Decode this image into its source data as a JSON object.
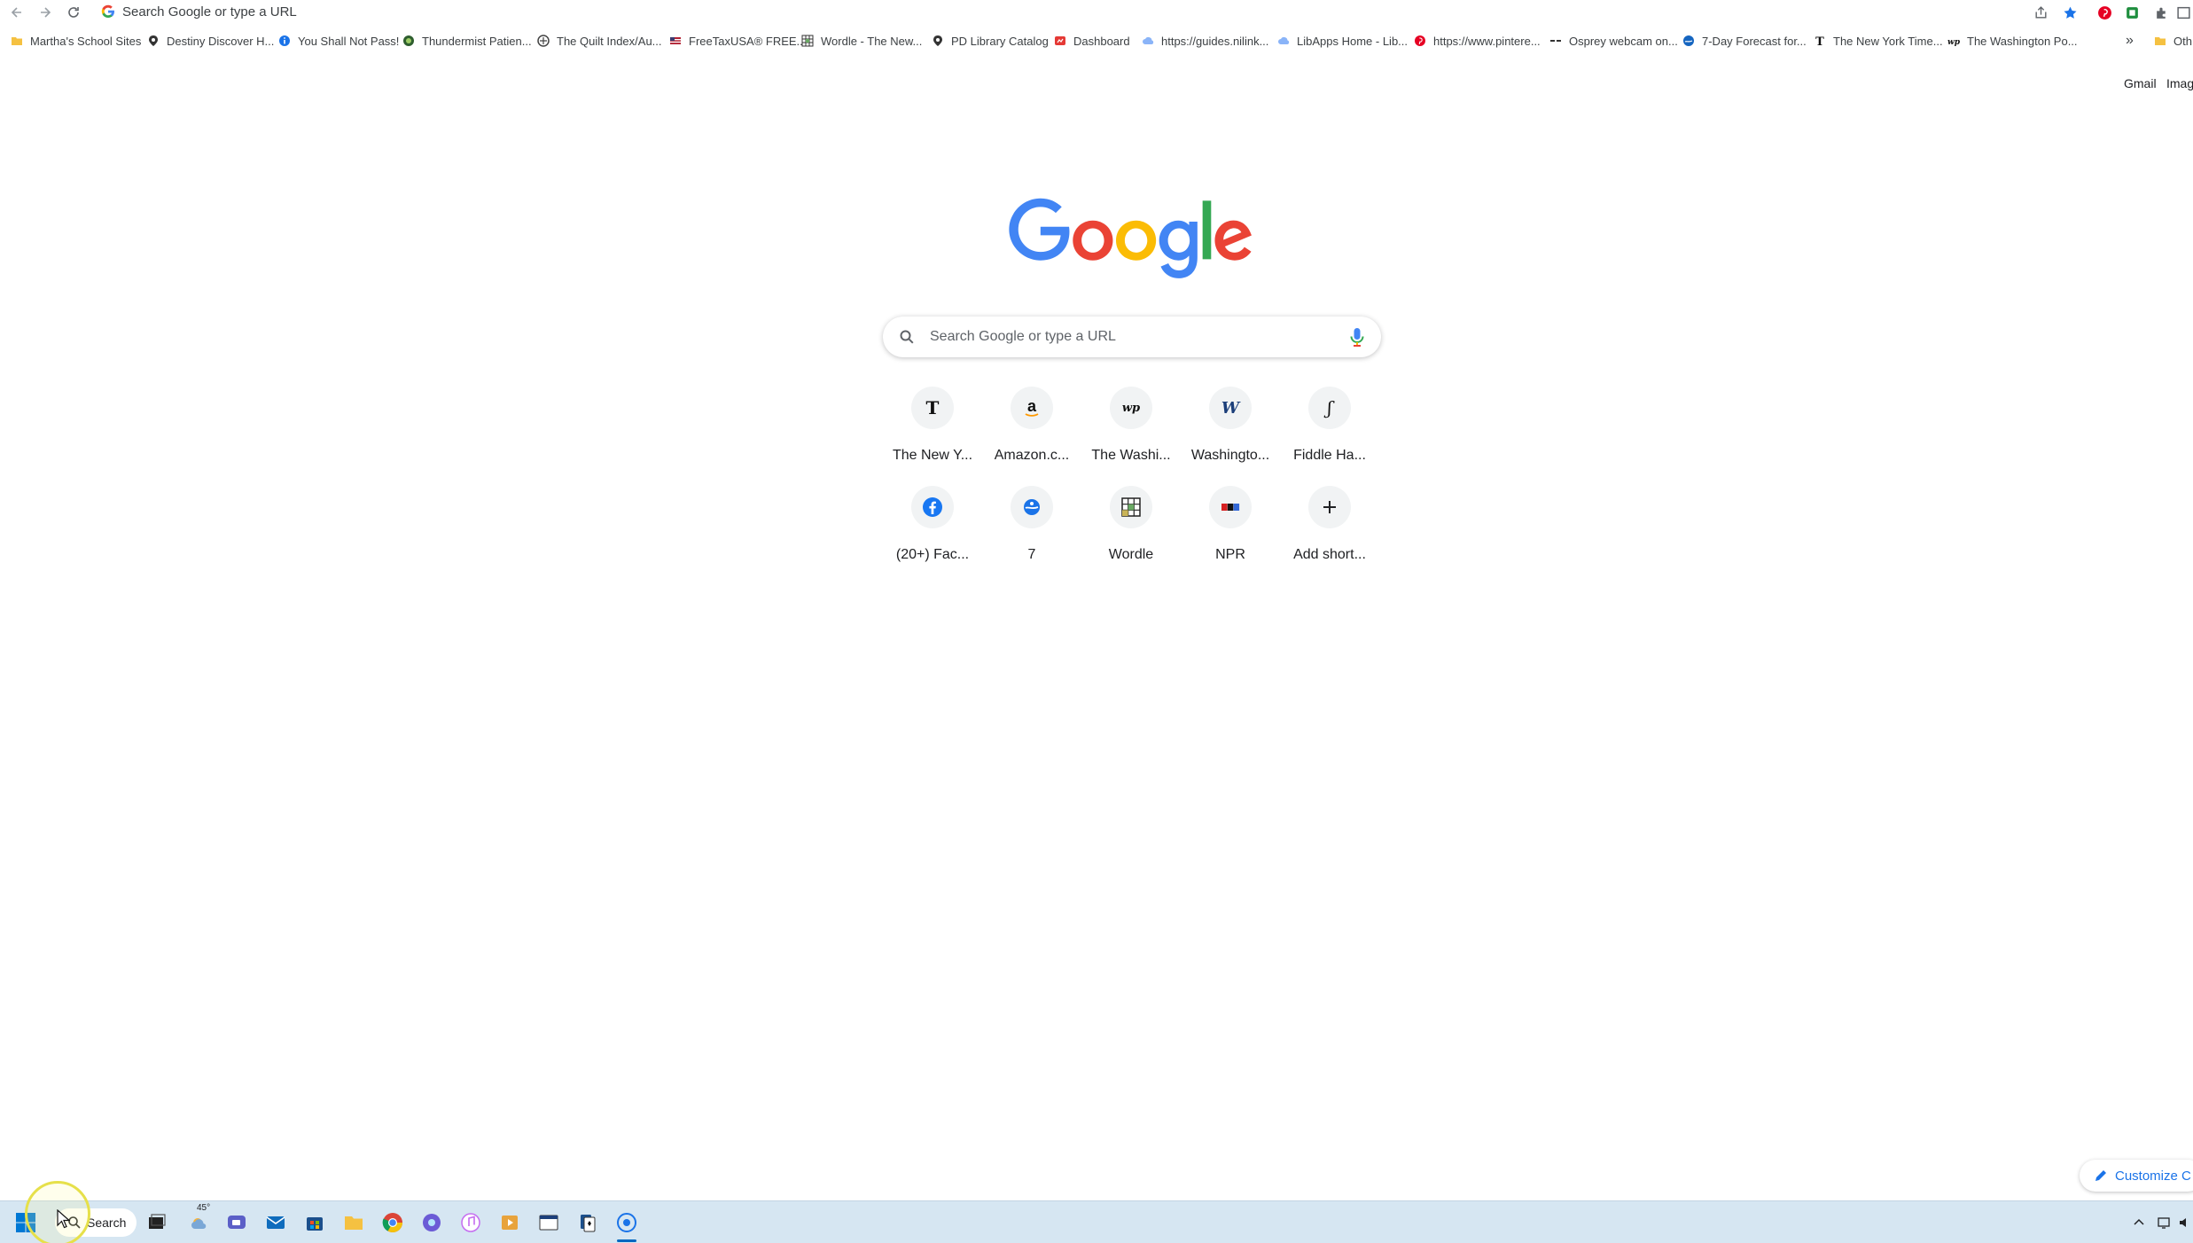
{
  "browser": {
    "omnibox_placeholder": "Search Google or type a URL"
  },
  "bookmarks": [
    {
      "label": "Martha's School Sites",
      "icon": "folder-icon"
    },
    {
      "label": "Destiny Discover H...",
      "icon": "destiny-icon"
    },
    {
      "label": "You Shall Not Pass!",
      "icon": "info-icon"
    },
    {
      "label": "Thundermist Patien...",
      "icon": "thundermist-icon"
    },
    {
      "label": "The Quilt Index/Au...",
      "icon": "quilt-index-icon"
    },
    {
      "label": "FreeTaxUSA® FREE...",
      "icon": "flag-icon"
    },
    {
      "label": "Wordle - The New...",
      "icon": "wordle-icon"
    },
    {
      "label": "PD Library Catalog",
      "icon": "destiny-icon"
    },
    {
      "label": "Dashboard",
      "icon": "dashboard-icon"
    },
    {
      "label": "https://guides.nilink...",
      "icon": "cloud-icon"
    },
    {
      "label": "LibApps Home - Lib...",
      "icon": "cloud-icon"
    },
    {
      "label": "https://www.pintere...",
      "icon": "pinterest-icon"
    },
    {
      "label": "Osprey webcam on...",
      "icon": "osprey-icon"
    },
    {
      "label": "7-Day Forecast for...",
      "icon": "noaa-icon"
    },
    {
      "label": "The New York Time...",
      "icon": "nyt-icon"
    },
    {
      "label": "The Washington Po...",
      "icon": "wapo-icon"
    }
  ],
  "bookmarks_overflow": "»",
  "other_bookmarks": "Oth",
  "top_links": {
    "gmail": "Gmail",
    "images": "Imag"
  },
  "search": {
    "placeholder": "Search Google or type a URL"
  },
  "shortcuts": [
    {
      "label": "The New Y...",
      "icon": "nyt-icon"
    },
    {
      "label": "Amazon.c...",
      "icon": "amazon-icon"
    },
    {
      "label": "The Washi...",
      "icon": "wapo-icon"
    },
    {
      "label": "Washingto...",
      "icon": "washington-w-icon"
    },
    {
      "label": "Fiddle Ha...",
      "icon": "fiddle-icon"
    },
    {
      "label": "(20+) Fac...",
      "icon": "facebook-icon"
    },
    {
      "label": "7",
      "icon": "noaa-icon"
    },
    {
      "label": "Wordle",
      "icon": "wordle-icon"
    },
    {
      "label": "NPR",
      "icon": "npr-icon"
    },
    {
      "label": "Add short...",
      "icon": "plus-icon"
    }
  ],
  "customize_label": "Customize C",
  "taskbar": {
    "search_label": "Search",
    "weather_temp": "45°"
  },
  "colors": {
    "google_blue": "#4285F4",
    "google_red": "#EA4335",
    "google_yellow": "#FBBC05",
    "google_green": "#34A853",
    "taskbar_bg": "#d6e6f2",
    "accent": "#1a73e8"
  }
}
